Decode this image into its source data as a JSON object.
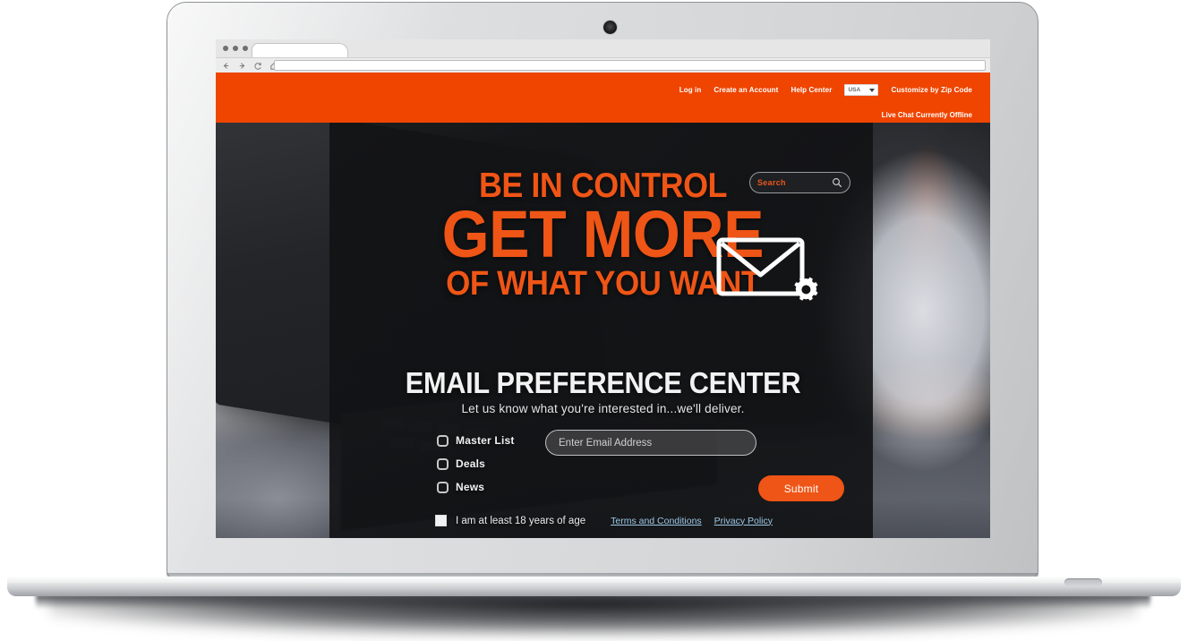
{
  "browser": {
    "nav": {
      "back_icon": "arrow-left-icon",
      "forward_icon": "arrow-right-icon",
      "reload_icon": "reload-icon",
      "home_icon": "home-icon"
    },
    "url_value": "",
    "url_placeholder": "",
    "tab_title": ""
  },
  "header": {
    "background_color": "#ef4500",
    "links": [
      {
        "label": "Log in"
      },
      {
        "label": "Create an Account"
      },
      {
        "label": "Help Center"
      }
    ],
    "country_select": {
      "value": "USA",
      "caret_icon": "chevron-down-icon"
    },
    "zip_link": "Customize by Zip Code",
    "live_chat_status": "Live Chat Currently Offline"
  },
  "hero": {
    "search": {
      "placeholder": "Search",
      "value": "",
      "icon": "search-icon",
      "text_color": "#e8561c"
    },
    "headline": {
      "line1": "BE IN CONTROL",
      "line2": "GET MORE",
      "line3": "OF WHAT YOU WANT",
      "color": "#ef5516",
      "icon": "envelope-gear-icon"
    },
    "title": "EMAIL PREFERENCE CENTER",
    "subtitle": "Let us know what you're interested in...we'll deliver.",
    "preferences": [
      {
        "label": "Master List",
        "checked": false
      },
      {
        "label": "Deals",
        "checked": false
      },
      {
        "label": "News",
        "checked": false
      }
    ],
    "email_field": {
      "placeholder": "Enter Email Address",
      "value": ""
    },
    "submit_label": "Submit",
    "age_consent": {
      "label": "I am at least 18 years of age",
      "checked": false
    },
    "legal_links": [
      {
        "label": "Terms and Conditions"
      },
      {
        "label": "Privacy Policy"
      }
    ],
    "link_color": "#9dc9e8"
  }
}
